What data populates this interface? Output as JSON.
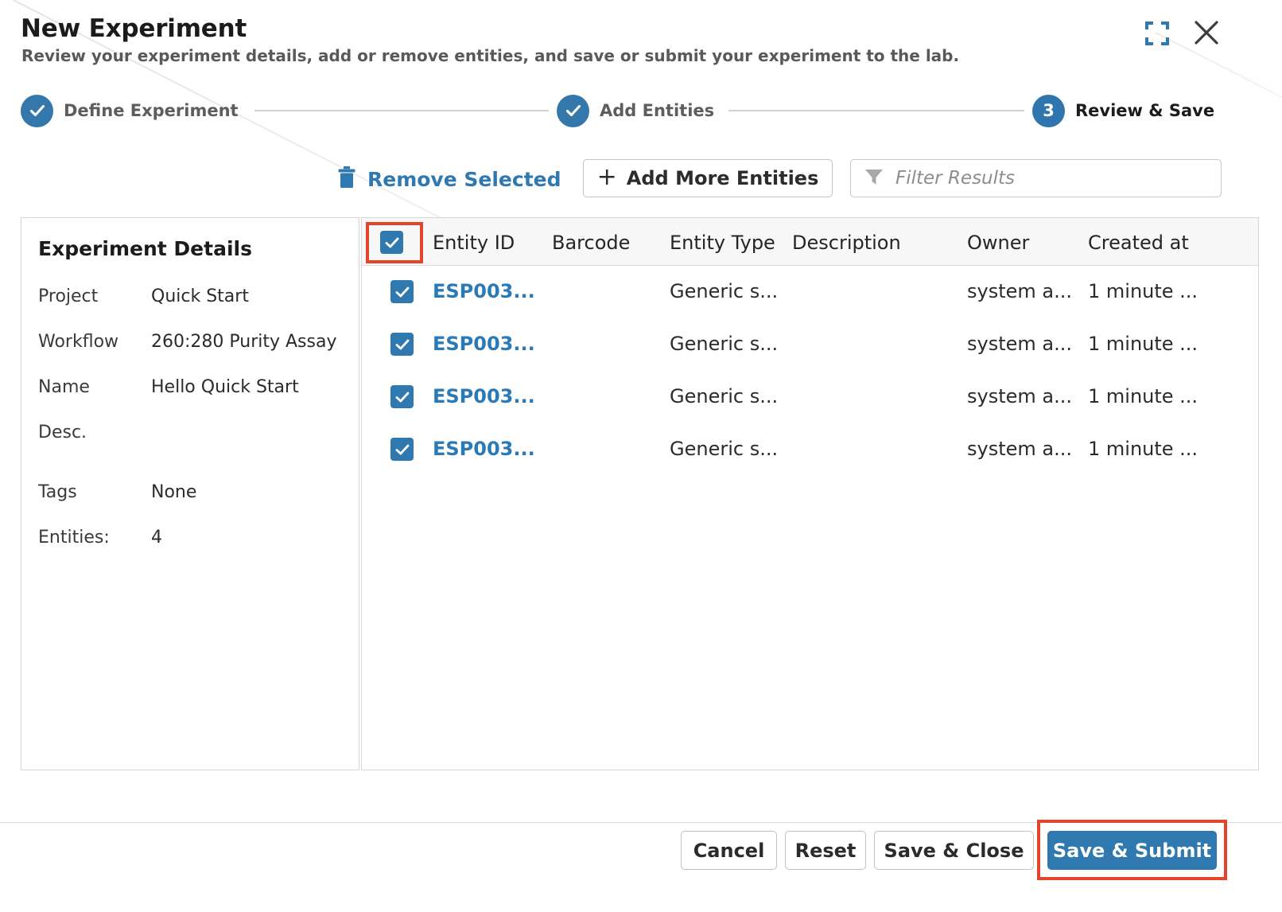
{
  "dialog": {
    "title": "New Experiment",
    "subtitle": "Review your experiment details, add or remove entities, and save or submit your experiment to the lab.",
    "maximize_icon": "maximize-icon",
    "close_icon": "close-icon"
  },
  "stepper": {
    "steps": [
      {
        "label": "Define Experiment",
        "state": "complete",
        "marker": "check"
      },
      {
        "label": "Add Entities",
        "state": "complete",
        "marker": "check"
      },
      {
        "label": "Review & Save",
        "state": "current",
        "marker": "3"
      }
    ]
  },
  "toolbar": {
    "remove_selected_label": "Remove Selected",
    "remove_selected_icon": "trash-icon",
    "add_more_entities_label": "Add More Entities",
    "add_more_entities_icon": "plus-icon",
    "filter_icon": "funnel-icon",
    "filter_placeholder": "Filter Results",
    "filter_value": ""
  },
  "details": {
    "title": "Experiment Details",
    "rows": [
      {
        "key": "Project",
        "value": "Quick Start"
      },
      {
        "key": "Workflow",
        "value": "260:280 Purity Assay"
      },
      {
        "key": "Name",
        "value": "Hello Quick Start"
      },
      {
        "key": "Desc.",
        "value": ""
      },
      {
        "key": "Tags",
        "value": "None"
      },
      {
        "key": "Entities:",
        "value": "4"
      }
    ]
  },
  "table": {
    "select_all_checked": true,
    "columns": [
      "Entity ID",
      "Barcode",
      "Entity Type",
      "Description",
      "Owner",
      "Created at"
    ],
    "rows": [
      {
        "checked": true,
        "entity_id": "ESP003...",
        "barcode": "",
        "entity_type": "Generic s...",
        "description": "",
        "owner": "system a...",
        "created_at": "1 minute ..."
      },
      {
        "checked": true,
        "entity_id": "ESP003...",
        "barcode": "",
        "entity_type": "Generic s...",
        "description": "",
        "owner": "system a...",
        "created_at": "1 minute ..."
      },
      {
        "checked": true,
        "entity_id": "ESP003...",
        "barcode": "",
        "entity_type": "Generic s...",
        "description": "",
        "owner": "system a...",
        "created_at": "1 minute ..."
      },
      {
        "checked": true,
        "entity_id": "ESP003...",
        "barcode": "",
        "entity_type": "Generic s...",
        "description": "",
        "owner": "system a...",
        "created_at": "1 minute ..."
      }
    ]
  },
  "footer": {
    "cancel_label": "Cancel",
    "reset_label": "Reset",
    "save_close_label": "Save & Close",
    "save_submit_label": "Save & Submit"
  },
  "colors": {
    "accent_blue": "#3079b0",
    "link_blue": "#2b7ab8",
    "highlight_red": "#e2452b",
    "header_bg": "#f7f7f7",
    "border": "#d6d6d6"
  }
}
